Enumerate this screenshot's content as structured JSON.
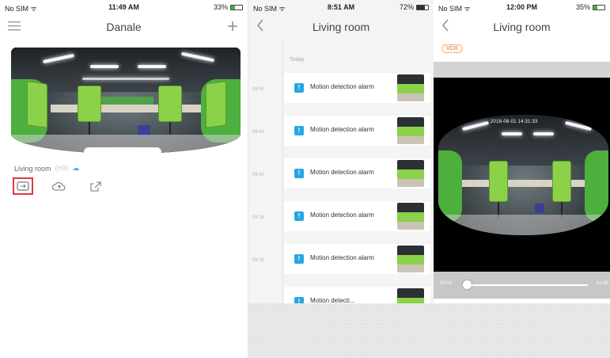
{
  "phone1": {
    "status": {
      "carrier": "No SIM ᯤ",
      "time": "11:49 AM",
      "battery": "33%"
    },
    "nav": {
      "title": "Danale",
      "menu_icon": "menu-icon",
      "add_icon": "plus-icon"
    },
    "camera": {
      "name": "Living room",
      "sub": "(HD)"
    },
    "actions": [
      "playback-icon",
      "cloud-icon",
      "share-icon"
    ]
  },
  "phone2": {
    "status": {
      "carrier": "No SIM ᯤ",
      "time": "8:51 AM",
      "battery": "72%"
    },
    "nav": {
      "title": "Living room"
    },
    "section_label": "Today",
    "events": [
      {
        "time": "08:48",
        "title": "Motion detection alarm"
      },
      {
        "time": "08:43",
        "title": "Motion detection alarm"
      },
      {
        "time": "08:40",
        "title": "Motion detection alarm"
      },
      {
        "time": "08:38",
        "title": "Motion detection alarm"
      },
      {
        "time": "08:35",
        "title": "Motion detection alarm"
      },
      {
        "time": "",
        "title": "Motion detecti..."
      }
    ]
  },
  "phone3": {
    "status": {
      "carrier": "No SIM ᯤ",
      "time": "12:00 PM",
      "battery": "35%"
    },
    "nav": {
      "title": "Living room"
    },
    "vcr_label": "VCR",
    "timestamp": "2018-08-01 14:31:33",
    "playback": {
      "current": "00:02",
      "end": "01:50",
      "progress": 0.02
    }
  },
  "colors": {
    "accent_blue": "#27a7e2",
    "highlight_red": "#e0393b",
    "chair_green": "#8bd24a"
  }
}
